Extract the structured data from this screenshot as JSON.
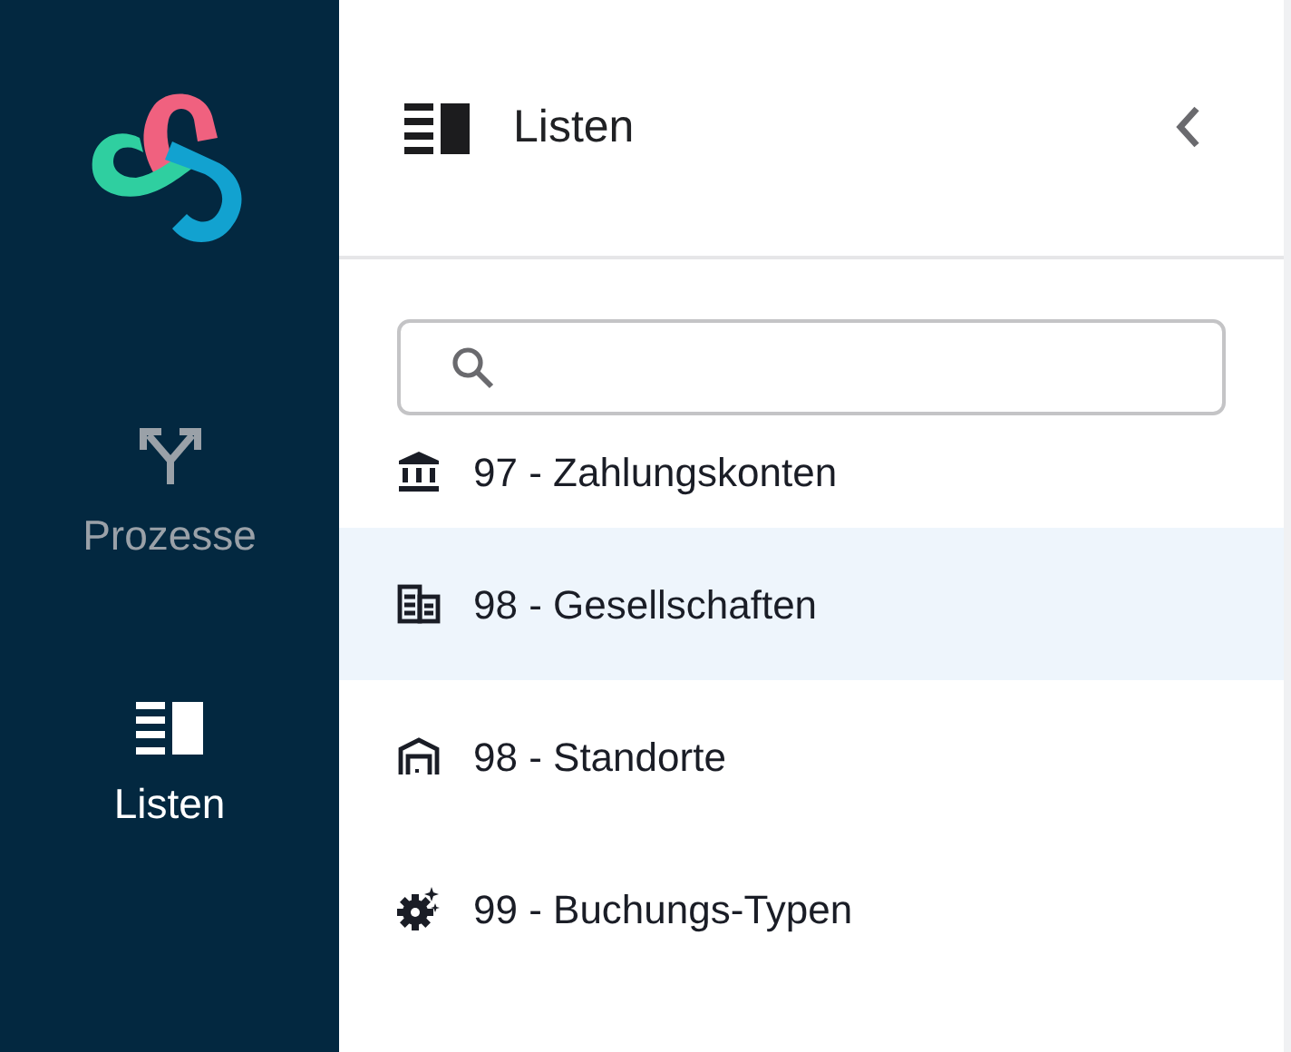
{
  "sidebar": {
    "items": [
      {
        "label": "Prozesse",
        "selected": false
      },
      {
        "label": "Listen",
        "selected": true
      }
    ]
  },
  "panel": {
    "title": "Listen",
    "items": [
      {
        "label": "97 - Zahlungskonten",
        "selected": false
      },
      {
        "label": "98 - Gesellschaften",
        "selected": true
      },
      {
        "label": "98 - Standorte",
        "selected": false
      },
      {
        "label": "99 - Buchungs-Typen",
        "selected": false
      }
    ]
  }
}
